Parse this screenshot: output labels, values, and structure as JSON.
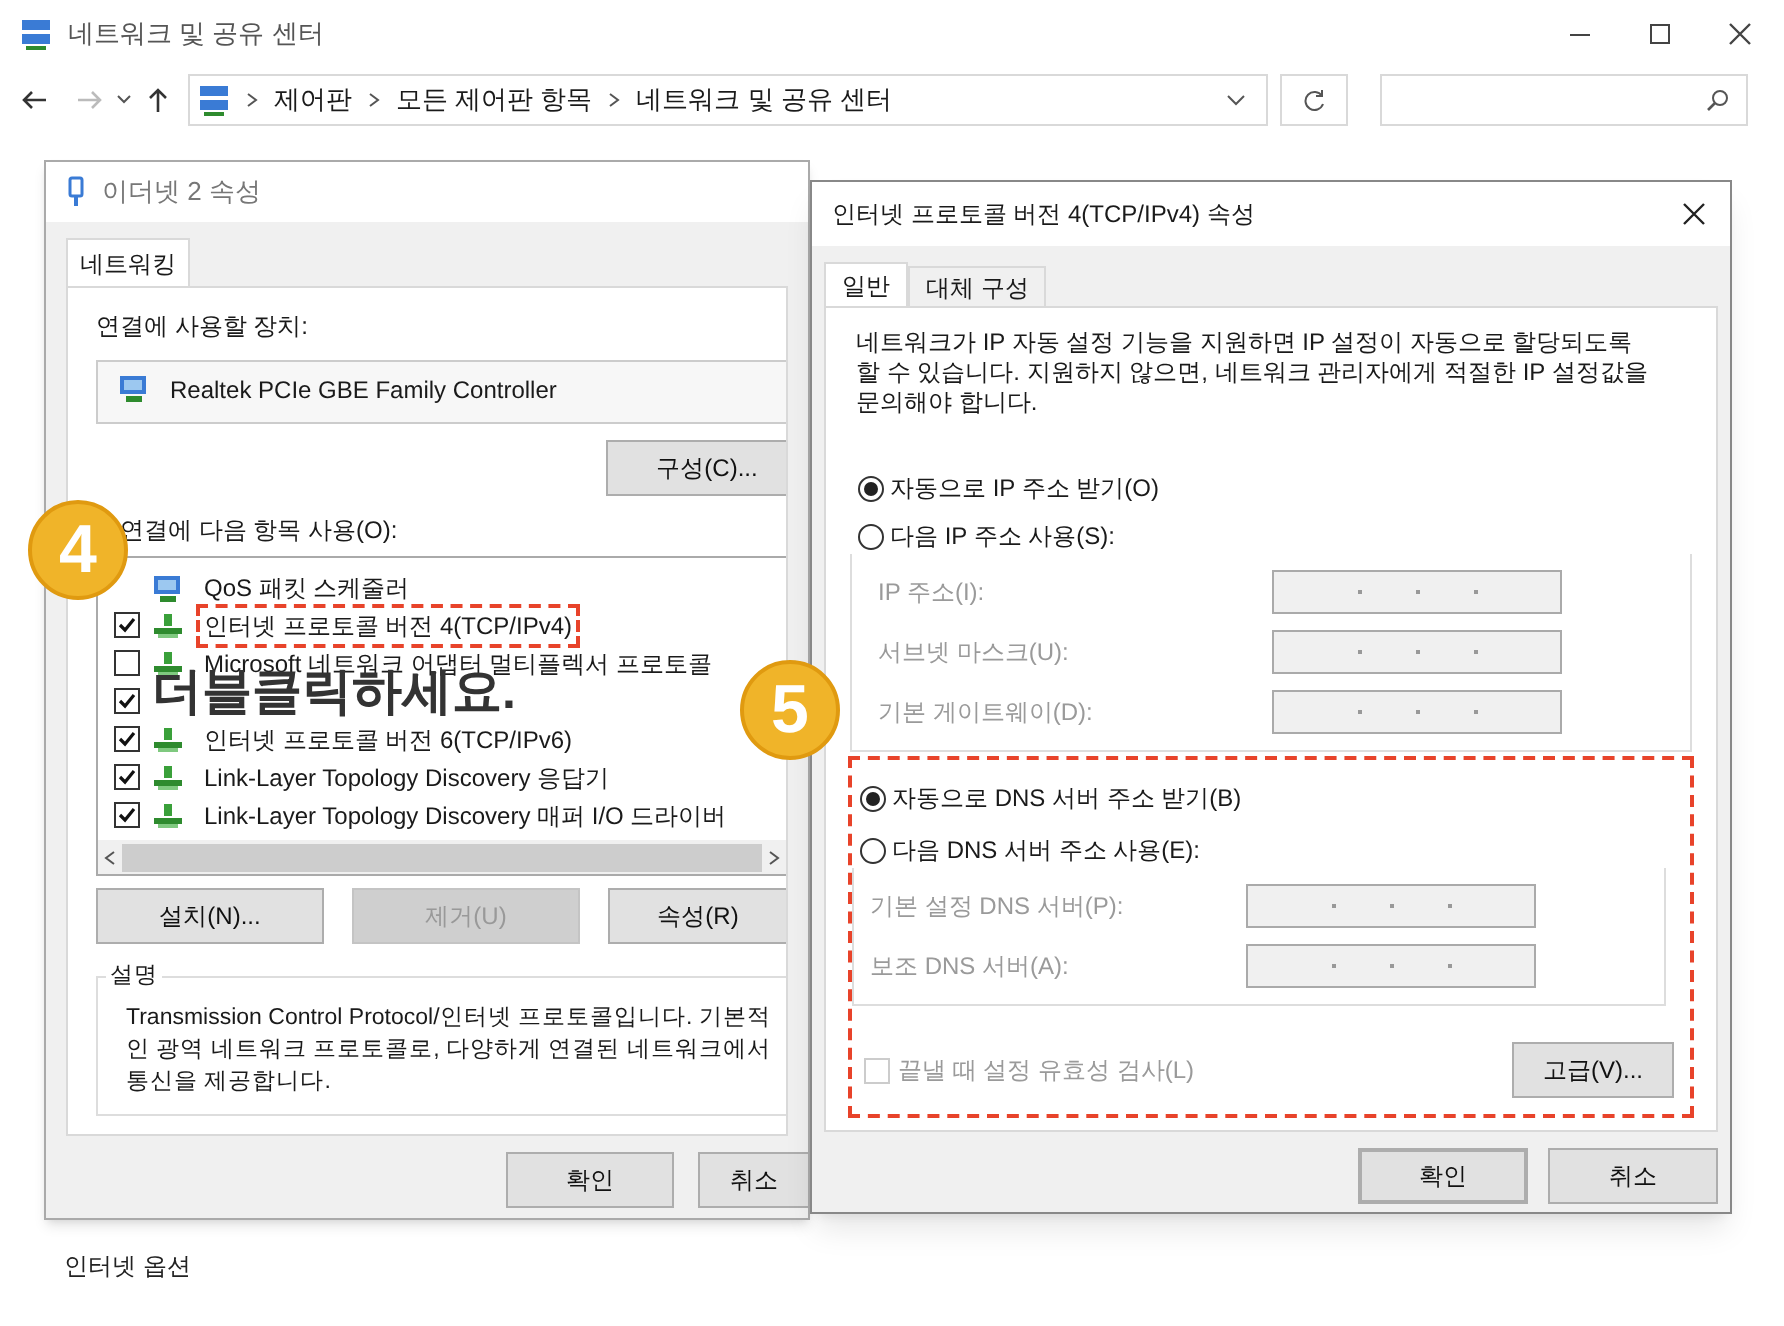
{
  "main_window": {
    "title": "네트워크 및 공유 센터",
    "breadcrumbs": [
      "제어판",
      "모든 제어판 항목",
      "네트워크 및 공유 센터"
    ],
    "links": [
      "인터넷 옵션"
    ]
  },
  "ethernet_dialog": {
    "title": "이더넷 2 속성",
    "tabs": [
      {
        "label": "네트워킹",
        "selected": true
      }
    ],
    "device_label": "연결에 사용할 장치:",
    "device": "Realtek PCIe GBE Family Controller",
    "configure_button": "구성(C)...",
    "items_label": "연결에 다음 항목 사용(O):",
    "items": [
      {
        "label": "QoS 패킷 스케줄러",
        "kind": "service"
      },
      {
        "label": "인터넷 프로토콜 버전 4(TCP/IPv4)",
        "checked": true,
        "highlighted": true,
        "kind": "protocol"
      },
      {
        "label": "Microsoft 네트워크 어댑터 멀티플렉서 프로토콜",
        "checked": false,
        "kind": "protocol"
      },
      {
        "checked": true
      },
      {
        "label": "인터넷 프로토콜 버전 6(TCP/IPv6)",
        "checked": true,
        "kind": "protocol"
      },
      {
        "label": "Link-Layer Topology Discovery 응답기",
        "checked": true,
        "kind": "protocol"
      },
      {
        "label": "Link-Layer Topology Discovery 매퍼 I/O 드라이버",
        "checked": true,
        "kind": "protocol"
      }
    ],
    "buttons": [
      {
        "label": "설치(N)...",
        "disabled": false
      },
      {
        "label": "제거(U)",
        "disabled": true
      },
      {
        "label": "속성(R)",
        "disabled": false
      }
    ],
    "description_title": "설명",
    "description": "Transmission Control Protocol/인터넷 프로토콜입니다. 기본적인 광역 네트워크 프로토콜로, 다양하게 연결된 네트워크에서 통신을 제공합니다.",
    "footer_buttons": [
      "확인",
      "취소"
    ]
  },
  "ipv4_dialog": {
    "title": "인터넷 프로토콜 버전 4(TCP/IPv4) 속성",
    "tabs": [
      {
        "label": "일반",
        "selected": true
      },
      {
        "label": "대체 구성",
        "selected": false
      }
    ],
    "intro": "네트워크가 IP 자동 설정 기능을 지원하면 IP 설정이 자동으로 할당되도록 할 수 있습니다. 지원하지 않으면, 네트워크 관리자에게 적절한 IP 설정값을 문의해야 합니다.",
    "ip_options": [
      {
        "label": "자동으로 IP 주소 받기(O)",
        "selected": true
      },
      {
        "label": "다음 IP 주소 사용(S):",
        "selected": false
      }
    ],
    "ip_fields": [
      {
        "label": "IP 주소(I):",
        "disabled": true
      },
      {
        "label": "서브넷 마스크(U):",
        "disabled": true
      },
      {
        "label": "기본 게이트웨이(D):",
        "disabled": true
      }
    ],
    "dns_options": [
      {
        "label": "자동으로 DNS 서버 주소 받기(B)",
        "selected": true
      },
      {
        "label": "다음 DNS 서버 주소 사용(E):",
        "selected": false
      }
    ],
    "dns_fields": [
      {
        "label": "기본 설정 DNS 서버(P):",
        "disabled": true
      },
      {
        "label": "보조 DNS 서버(A):",
        "disabled": true
      }
    ],
    "validate": {
      "label": "끝낼 때 설정 유효성 검사(L)",
      "checked": false,
      "disabled": true
    },
    "advanced_button": "고급(V)...",
    "footer_buttons": [
      {
        "label": "확인",
        "default": true
      },
      {
        "label": "취소",
        "default": false
      }
    ]
  },
  "annotations": [
    {
      "kind": "step",
      "text": "4"
    },
    {
      "kind": "step",
      "text": "5"
    },
    {
      "kind": "note",
      "text": "더블클릭하세요."
    }
  ]
}
